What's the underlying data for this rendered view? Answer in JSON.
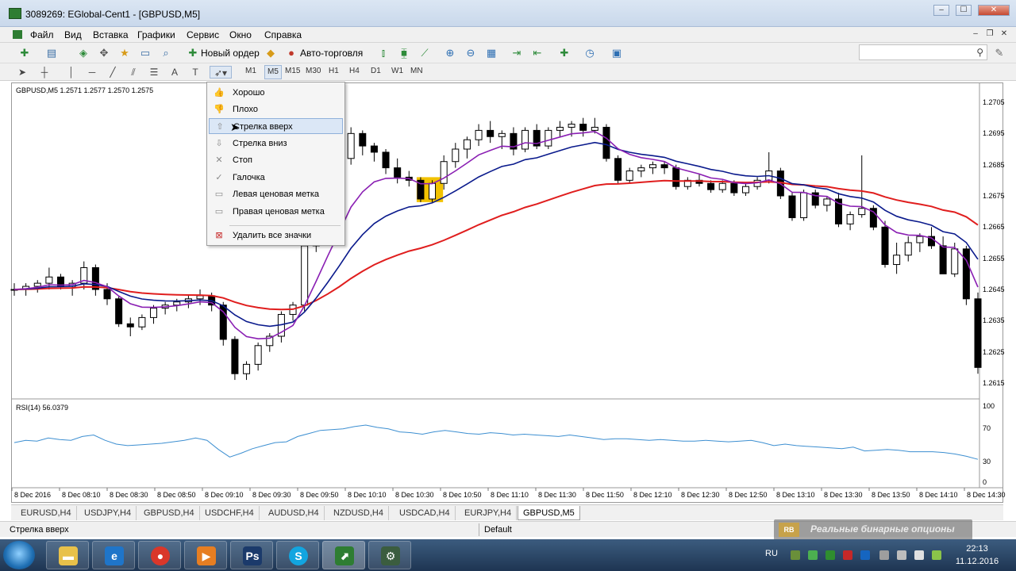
{
  "window": {
    "title": "3089269: EGlobal-Cent1 - [GBPUSD,M5]",
    "min": "–",
    "max": "☐",
    "close": "✕"
  },
  "menu": [
    "Файл",
    "Вид",
    "Вставка",
    "Графики",
    "Сервис",
    "Окно",
    "Справка"
  ],
  "toolbar1": {
    "new_order": "Новый ордер",
    "auto_trading": "Авто-торговля",
    "search_placeholder": ""
  },
  "timeframes": [
    "M1",
    "M5",
    "M15",
    "M30",
    "H1",
    "H4",
    "D1",
    "W1",
    "MN"
  ],
  "active_timeframe": "M5",
  "chart": {
    "header": "GBPUSD,M5  1.2571 1.2577 1.2570 1.2575",
    "rsi_header": "RSI(14) 56.0379",
    "y_labels": [
      "1.2705",
      "1.2695",
      "1.2685",
      "1.2675",
      "1.2665",
      "1.2655",
      "1.2645",
      "1.2635",
      "1.2625",
      "1.2615"
    ],
    "rsi_labels": [
      "100",
      "70",
      "30",
      "0"
    ],
    "x_labels": [
      "8 Dec 2016",
      "8 Dec 08:10",
      "8 Dec 08:30",
      "8 Dec 08:50",
      "8 Dec 09:10",
      "8 Dec 09:30",
      "8 Dec 09:50",
      "8 Dec 10:10",
      "8 Dec 10:30",
      "8 Dec 10:50",
      "8 Dec 11:10",
      "8 Dec 11:30",
      "8 Dec 11:50",
      "8 Dec 12:10",
      "8 Dec 12:30",
      "8 Dec 12:50",
      "8 Dec 13:10",
      "8 Dec 13:30",
      "8 Dec 13:50",
      "8 Dec 14:10",
      "8 Dec 14:30"
    ]
  },
  "dropdown": {
    "items": [
      "Хорошо",
      "Плохо",
      "Стрелка вверх",
      "Стрелка вниз",
      "Стоп",
      "Галочка",
      "Левая ценовая метка",
      "Правая ценовая метка"
    ],
    "delete_all": "Удалить все значки",
    "highlighted": "Стрелка вверх"
  },
  "tabs": [
    "EURUSD,H4",
    "USDJPY,H4",
    "GBPUSD,H4",
    "USDCHF,H4",
    "AUDUSD,H4",
    "NZDUSD,H4",
    "USDCAD,H4",
    "EURJPY,H4",
    "GBPUSD,M5"
  ],
  "active_tab": "GBPUSD,M5",
  "status": {
    "text": "Стрелка вверх",
    "profile": "Default"
  },
  "watermark": {
    "logo": "RB",
    "text": "Реальные бинарные опционы"
  },
  "taskbar": {
    "lang": "RU",
    "time": "22:13",
    "date": "11.12.2016"
  },
  "colors": {
    "ema_fast": "#8a1fb3",
    "ema_mid": "#0a1a8c",
    "ema_slow": "#e01e1e",
    "rsi": "#3d8fd1",
    "highlight_candle": "#f2c200"
  },
  "chart_data": {
    "type": "candlestick",
    "symbol": "GBPUSD",
    "timeframe": "M5",
    "ylim": [
      1.261,
      1.271
    ],
    "rsi_ylim": [
      0,
      100
    ],
    "candles": [
      [
        1.2645,
        1.2647,
        1.2643,
        1.2645
      ],
      [
        1.2645,
        1.2647,
        1.2643,
        1.2646
      ],
      [
        1.2646,
        1.2648,
        1.2644,
        1.2647
      ],
      [
        1.2647,
        1.2652,
        1.2645,
        1.2649
      ],
      [
        1.2649,
        1.265,
        1.2645,
        1.2646
      ],
      [
        1.2646,
        1.2648,
        1.2643,
        1.2647
      ],
      [
        1.2647,
        1.2654,
        1.2645,
        1.2652
      ],
      [
        1.2652,
        1.2653,
        1.2643,
        1.2645
      ],
      [
        1.2645,
        1.2647,
        1.264,
        1.2642
      ],
      [
        1.2642,
        1.2643,
        1.2633,
        1.2634
      ],
      [
        1.2634,
        1.2636,
        1.263,
        1.2633
      ],
      [
        1.2633,
        1.2637,
        1.2632,
        1.2636
      ],
      [
        1.2636,
        1.264,
        1.2634,
        1.2639
      ],
      [
        1.2639,
        1.2641,
        1.2637,
        1.264
      ],
      [
        1.264,
        1.2642,
        1.2638,
        1.2641
      ],
      [
        1.2641,
        1.2643,
        1.2639,
        1.2642
      ],
      [
        1.2642,
        1.2645,
        1.264,
        1.2643
      ],
      [
        1.2643,
        1.2644,
        1.2638,
        1.264
      ],
      [
        1.264,
        1.2641,
        1.2627,
        1.2629
      ],
      [
        1.2629,
        1.263,
        1.2616,
        1.2618
      ],
      [
        1.2618,
        1.2622,
        1.2616,
        1.2621
      ],
      [
        1.2621,
        1.2628,
        1.2619,
        1.2627
      ],
      [
        1.2627,
        1.2631,
        1.2625,
        1.263
      ],
      [
        1.263,
        1.2638,
        1.2628,
        1.2637
      ],
      [
        1.2637,
        1.2641,
        1.2635,
        1.264
      ],
      [
        1.264,
        1.266,
        1.2638,
        1.2659
      ],
      [
        1.2659,
        1.2672,
        1.2657,
        1.2671
      ],
      [
        1.2671,
        1.2682,
        1.2669,
        1.268
      ],
      [
        1.268,
        1.269,
        1.2677,
        1.2687
      ],
      [
        1.2687,
        1.2697,
        1.2685,
        1.2695
      ],
      [
        1.2695,
        1.2696,
        1.2688,
        1.2691
      ],
      [
        1.2691,
        1.2692,
        1.2686,
        1.2689
      ],
      [
        1.2689,
        1.269,
        1.2682,
        1.2684
      ],
      [
        1.2684,
        1.2687,
        1.2679,
        1.2681
      ],
      [
        1.2681,
        1.2683,
        1.2678,
        1.268
      ],
      [
        1.268,
        1.2681,
        1.2673,
        1.2674
      ],
      [
        1.2674,
        1.268,
        1.2673,
        1.2679
      ],
      [
        1.2679,
        1.2688,
        1.2677,
        1.2686
      ],
      [
        1.2686,
        1.2692,
        1.2684,
        1.269
      ],
      [
        1.269,
        1.2694,
        1.2687,
        1.2693
      ],
      [
        1.2693,
        1.2698,
        1.2691,
        1.2696
      ],
      [
        1.2696,
        1.2699,
        1.2692,
        1.2694
      ],
      [
        1.2694,
        1.2696,
        1.269,
        1.2695
      ],
      [
        1.2695,
        1.2697,
        1.2688,
        1.269
      ],
      [
        1.269,
        1.2697,
        1.2689,
        1.2696
      ],
      [
        1.2696,
        1.2698,
        1.269,
        1.2691
      ],
      [
        1.2691,
        1.2697,
        1.269,
        1.2696
      ],
      [
        1.2696,
        1.2699,
        1.2694,
        1.2697
      ],
      [
        1.2697,
        1.2699,
        1.2694,
        1.2698
      ],
      [
        1.2698,
        1.27,
        1.2694,
        1.2696
      ],
      [
        1.2696,
        1.27,
        1.2695,
        1.2697
      ],
      [
        1.2697,
        1.2698,
        1.2686,
        1.2687
      ],
      [
        1.2687,
        1.2688,
        1.2679,
        1.268
      ],
      [
        1.268,
        1.2684,
        1.2679,
        1.2683
      ],
      [
        1.2683,
        1.2685,
        1.2681,
        1.2684
      ],
      [
        1.2684,
        1.2686,
        1.2682,
        1.2685
      ],
      [
        1.2685,
        1.2686,
        1.2682,
        1.2684
      ],
      [
        1.2684,
        1.2685,
        1.2677,
        1.2678
      ],
      [
        1.2678,
        1.2681,
        1.2677,
        1.268
      ],
      [
        1.268,
        1.2682,
        1.2678,
        1.2679
      ],
      [
        1.2679,
        1.268,
        1.2676,
        1.2677
      ],
      [
        1.2677,
        1.268,
        1.2676,
        1.2679
      ],
      [
        1.2679,
        1.268,
        1.2675,
        1.2676
      ],
      [
        1.2676,
        1.2679,
        1.2675,
        1.2678
      ],
      [
        1.2678,
        1.2681,
        1.2677,
        1.268
      ],
      [
        1.268,
        1.2689,
        1.2679,
        1.2683
      ],
      [
        1.2683,
        1.2684,
        1.2674,
        1.2675
      ],
      [
        1.2675,
        1.2676,
        1.2667,
        1.2668
      ],
      [
        1.2668,
        1.2677,
        1.2667,
        1.2676
      ],
      [
        1.2676,
        1.2677,
        1.2671,
        1.2672
      ],
      [
        1.2672,
        1.2675,
        1.267,
        1.2674
      ],
      [
        1.2674,
        1.2676,
        1.2665,
        1.2666
      ],
      [
        1.2666,
        1.267,
        1.2664,
        1.2669
      ],
      [
        1.2669,
        1.2688,
        1.2668,
        1.2671
      ],
      [
        1.2671,
        1.2672,
        1.2664,
        1.2665
      ],
      [
        1.2665,
        1.2667,
        1.2652,
        1.2653
      ],
      [
        1.2653,
        1.266,
        1.265,
        1.2656
      ],
      [
        1.2656,
        1.2662,
        1.2654,
        1.266
      ],
      [
        1.266,
        1.2663,
        1.2657,
        1.2662
      ],
      [
        1.2662,
        1.2665,
        1.2658,
        1.2659
      ],
      [
        1.2659,
        1.2662,
        1.265,
        1.265
      ],
      [
        1.265,
        1.266,
        1.2649,
        1.2658
      ],
      [
        1.2658,
        1.2659,
        1.264,
        1.2642
      ],
      [
        1.2642,
        1.2644,
        1.2618,
        1.262
      ]
    ],
    "rsi": [
      52,
      55,
      54,
      58,
      56,
      55,
      60,
      62,
      55,
      50,
      48,
      49,
      50,
      51,
      53,
      55,
      58,
      55,
      43,
      33,
      38,
      44,
      48,
      52,
      53,
      60,
      64,
      68,
      69,
      70,
      73,
      75,
      72,
      70,
      66,
      65,
      63,
      66,
      68,
      66,
      64,
      63,
      65,
      64,
      62,
      63,
      62,
      61,
      60,
      62,
      60,
      58,
      56,
      57,
      57,
      56,
      55,
      56,
      55,
      54,
      54,
      55,
      54,
      53,
      54,
      55,
      52,
      48,
      50,
      48,
      47,
      46,
      45,
      44,
      46,
      41,
      42,
      43,
      42,
      40,
      40,
      40,
      39,
      37,
      34,
      30
    ]
  }
}
